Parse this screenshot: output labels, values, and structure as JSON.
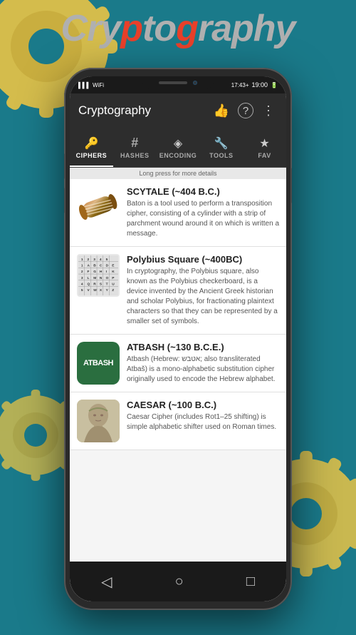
{
  "appTitle": {
    "prefix": "Cry",
    "highlight1": "p",
    "middle": "to",
    "highlight2": "g",
    "suffix": "raphy"
  },
  "statusBar": {
    "time": "19:00",
    "alarm": "17:43+",
    "signal": "▌▌▌",
    "wifi": "WiFi",
    "battery": "⬛"
  },
  "appBar": {
    "title": "Cryptography",
    "likeIcon": "👍",
    "helpIcon": "?",
    "menuIcon": "⋮"
  },
  "tabs": [
    {
      "id": "ciphers",
      "icon": "🔑",
      "label": "CIPHERS",
      "active": true
    },
    {
      "id": "hashes",
      "icon": "#",
      "label": "HASHES",
      "active": false
    },
    {
      "id": "encoding",
      "icon": "◈",
      "label": "ENCODING",
      "active": false
    },
    {
      "id": "tools",
      "icon": "🔧",
      "label": "TOOLS",
      "active": false
    },
    {
      "id": "fav",
      "icon": "★",
      "label": "FAV",
      "active": false
    }
  ],
  "longPressHint": "Long press for more details",
  "ciphers": [
    {
      "id": "scytale",
      "name": "SCYTALE (~404 B.C.)",
      "desc": "Baton is a tool used to perform a transposition cipher, consisting of a cylinder with a strip of parchment wound around it on which is written a message.",
      "thumbType": "scytale"
    },
    {
      "id": "polybius",
      "name": "Polybius Square (~400BC)",
      "desc": "In cryptography, the Polybius square, also known as the Polybius checkerboard, is a device invented by the Ancient Greek historian and scholar Polybius, for fractionating plaintext characters so that they can be represented by a smaller set of symbols.",
      "thumbType": "polybius"
    },
    {
      "id": "atbash",
      "name": "ATBASH (~130 B.C.E.)",
      "desc": "Atbash (Hebrew: אטבש; also transliterated Atbaš) is a mono-alphabetic substitution cipher originally used to encode the Hebrew alphabet.",
      "thumbType": "atbash",
      "thumbText": "ATBASH"
    },
    {
      "id": "caesar",
      "name": "CAESAR (~100 B.C.)",
      "desc": "Caesar Cipher (includes Rot1–25 shifting) is simple alphabetic shifter used on Roman times.",
      "thumbType": "caesar"
    }
  ],
  "bottomNav": {
    "back": "◁",
    "home": "○",
    "recent": "□"
  },
  "colors": {
    "accent": "#f5c842",
    "background": "#1a7a8a",
    "appBar": "#2d2d2d",
    "atbashBg": "#2a6e3f",
    "tabActive": "#ffffff"
  }
}
